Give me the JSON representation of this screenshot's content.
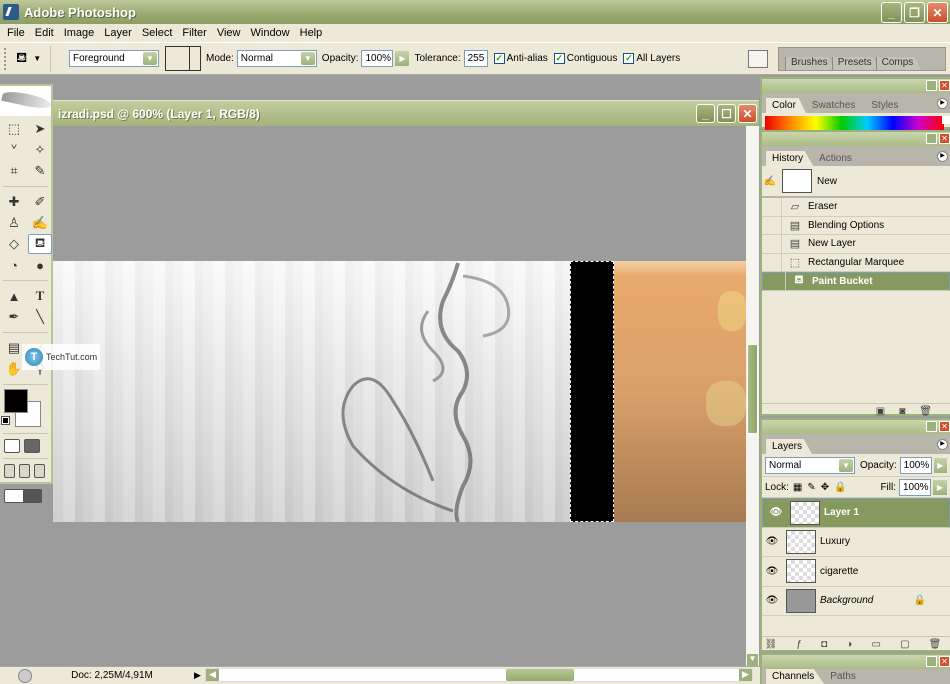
{
  "app": {
    "title": "Adobe Photoshop",
    "window_buttons": [
      "minimize",
      "restore",
      "close"
    ]
  },
  "menu": [
    "File",
    "Edit",
    "Image",
    "Layer",
    "Select",
    "Filter",
    "View",
    "Window",
    "Help"
  ],
  "options": {
    "fill_source": "Foreground",
    "mode_label": "Mode:",
    "mode_value": "Normal",
    "opacity_label": "Opacity:",
    "opacity_value": "100%",
    "tolerance_label": "Tolerance:",
    "tolerance_value": "255",
    "checkboxes": [
      {
        "label": "Anti-alias",
        "checked": true
      },
      {
        "label": "Contiguous",
        "checked": true
      },
      {
        "label": "All Layers",
        "checked": true
      }
    ],
    "palette_well_tabs": [
      "Brushes",
      "Presets",
      "Comps"
    ]
  },
  "document": {
    "title": "izradi.psd @ 600% (Layer 1, RGB/8)",
    "status_doc": "Doc: 2,25M/4,91M"
  },
  "toolbox": {
    "tools": [
      "rectangular-marquee",
      "move",
      "lasso",
      "magic-wand",
      "crop",
      "slice",
      "healing-brush",
      "brush",
      "clone-stamp",
      "history-brush",
      "eraser",
      "paint-bucket",
      "blur",
      "dodge",
      "path-selection",
      "type",
      "pen",
      "line",
      "notes",
      "eyedropper",
      "hand",
      "zoom"
    ],
    "active_tool": "paint-bucket",
    "foreground_color": "#000000",
    "background_color": "#ffffff"
  },
  "watermark": {
    "text": "TechTut.com"
  },
  "color_panel": {
    "tabs": [
      "Color",
      "Swatches",
      "Styles"
    ],
    "active": "Color"
  },
  "history_panel": {
    "tabs": [
      "History",
      "Actions"
    ],
    "active": "History",
    "snapshot": "New",
    "items": [
      {
        "label": "Eraser",
        "icon": "eraser-icon"
      },
      {
        "label": "Blending Options",
        "icon": "document-icon"
      },
      {
        "label": "New Layer",
        "icon": "document-icon"
      },
      {
        "label": "Rectangular Marquee",
        "icon": "marquee-icon"
      },
      {
        "label": "Paint Bucket",
        "icon": "paint-bucket-icon",
        "selected": true
      }
    ]
  },
  "layers_panel": {
    "tab": "Layers",
    "blend_mode": "Normal",
    "opacity_label": "Opacity:",
    "opacity_value": "100%",
    "lock_label": "Lock:",
    "fill_label": "Fill:",
    "fill_value": "100%",
    "layers": [
      {
        "name": "Layer 1",
        "selected": true,
        "visible": true
      },
      {
        "name": "Luxury",
        "visible": true
      },
      {
        "name": "cigarette",
        "visible": true
      },
      {
        "name": "Background",
        "visible": true,
        "locked": true
      }
    ]
  },
  "channels_panel": {
    "tabs": [
      "Channels",
      "Paths"
    ],
    "active": "Channels"
  }
}
